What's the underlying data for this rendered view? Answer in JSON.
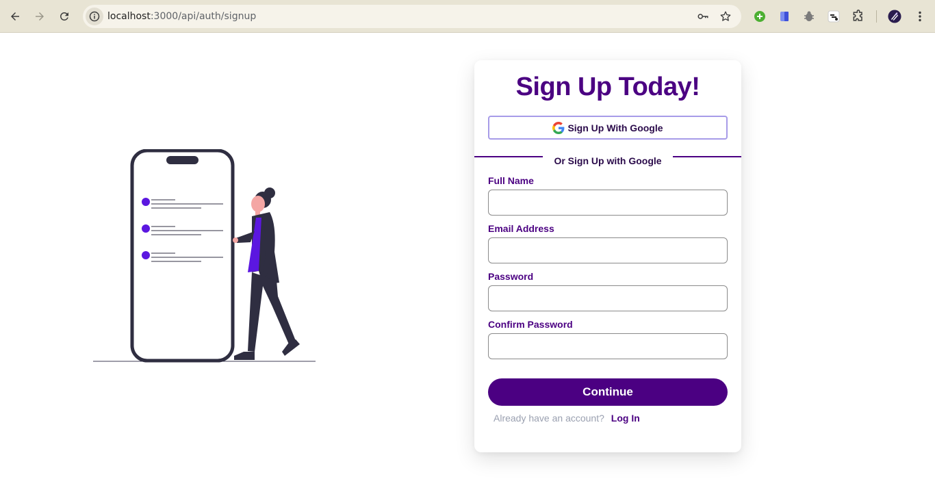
{
  "browser": {
    "url_host": "localhost",
    "url_path": ":3000/api/auth/signup"
  },
  "card": {
    "title": "Sign Up Today!",
    "google_button_label": "Sign Up With Google",
    "divider_text": "Or Sign Up with Google",
    "fields": [
      {
        "label": "Full Name",
        "value": "",
        "placeholder": ""
      },
      {
        "label": "Email Address",
        "value": "",
        "placeholder": ""
      },
      {
        "label": "Password",
        "value": "",
        "placeholder": ""
      },
      {
        "label": "Confirm Password",
        "value": "",
        "placeholder": ""
      }
    ],
    "continue_label": "Continue",
    "login_prompt": "Already have an account?",
    "login_link": "Log In"
  },
  "colors": {
    "brand_purple": "#4b0082",
    "accent_purple": "#5b17e0",
    "chrome_bg": "#e8e4d4"
  },
  "icons": [
    "back-icon",
    "forward-icon",
    "reload-icon",
    "info-icon",
    "key-icon",
    "star-icon",
    "extension-green-icon",
    "extension-blue-icon",
    "extension-bug-icon",
    "extension-dark-icon",
    "puzzle-icon",
    "profile-avatar-icon",
    "menu-dots-icon",
    "google-icon"
  ]
}
